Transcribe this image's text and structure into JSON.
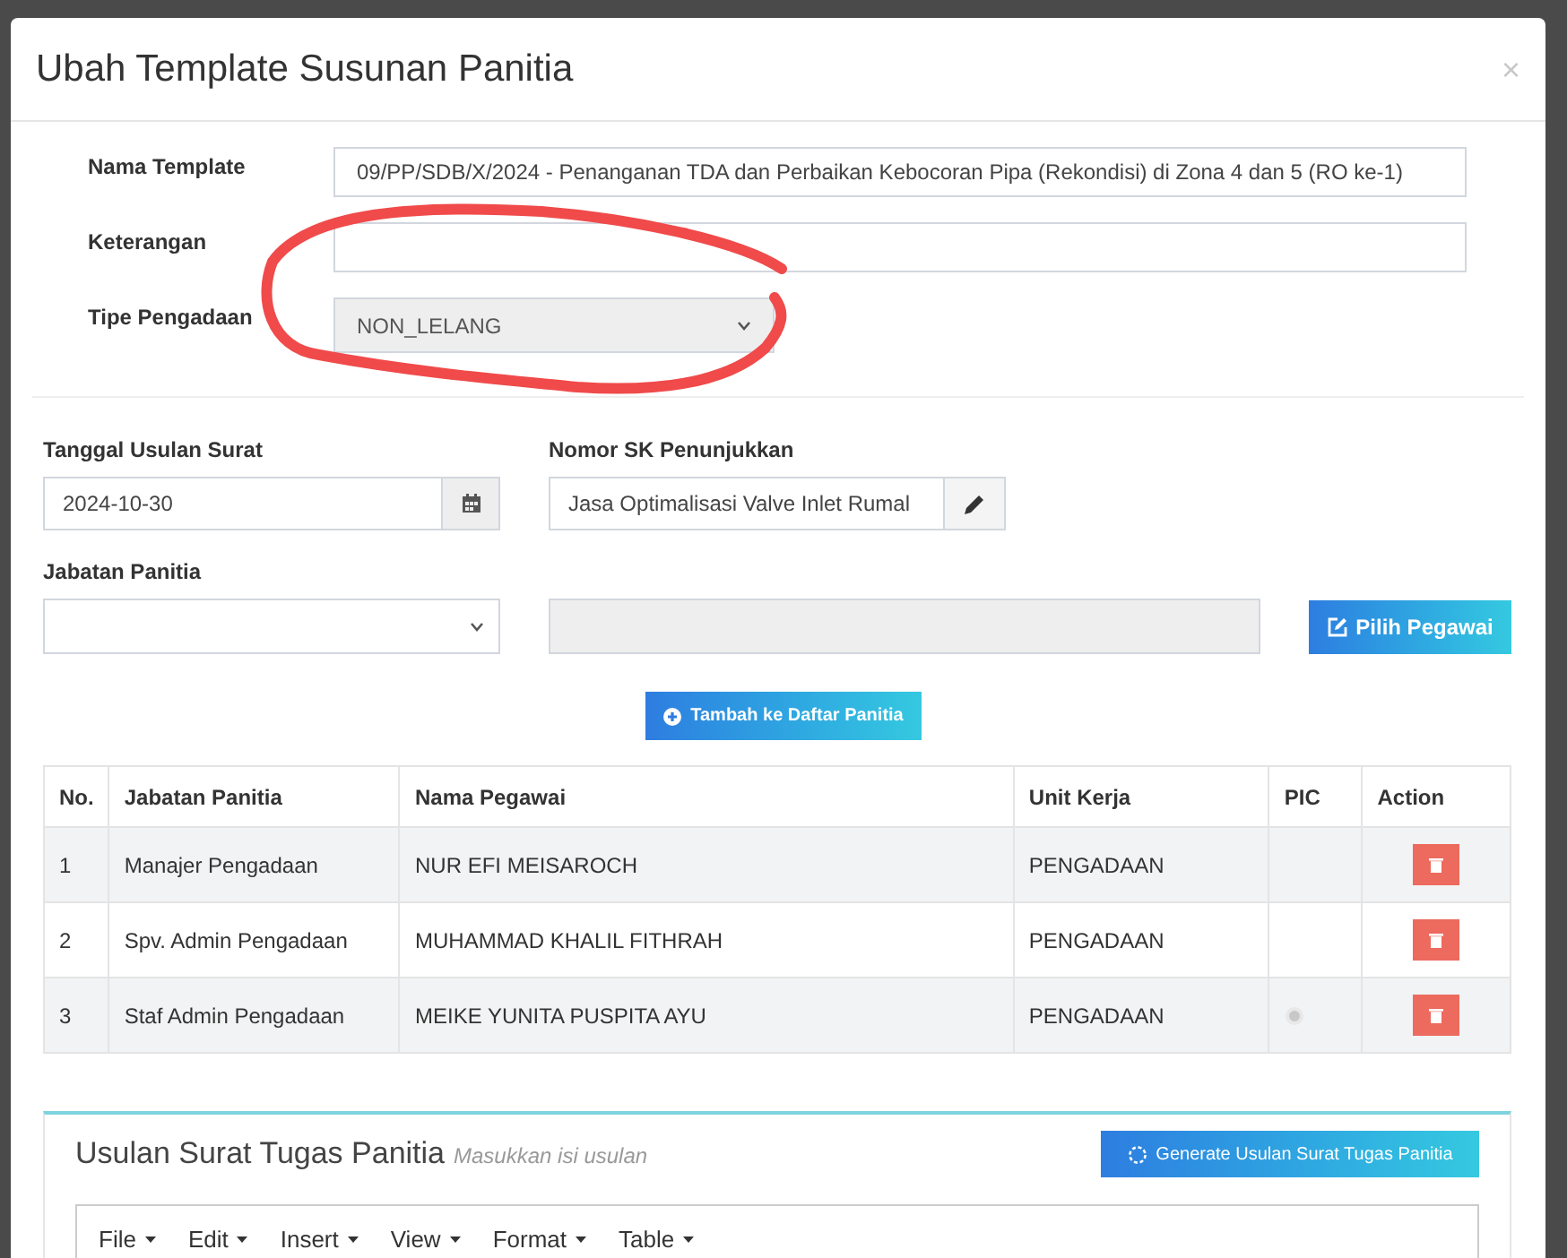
{
  "modal": {
    "title": "Ubah Template Susunan Panitia",
    "close": "×"
  },
  "template_form": [
    {
      "kind": "text",
      "label": "Nama Template",
      "value": "09/PP/SDB/X/2024 - Penanganan TDA dan Perbaikan Kebocoran Pipa (Rekondisi) di Zona 4 dan 5 (RO ke-1)"
    },
    {
      "kind": "text",
      "label": "Keterangan"
    },
    {
      "kind": "select",
      "label": "Tipe Pengadaan",
      "value": "NON_LELANG",
      "disabled": true
    }
  ],
  "tanggal": {
    "label": "Tanggal Usulan Surat",
    "value": "2024-10-30"
  },
  "nomor_sk": {
    "label": "Nomor SK Penunjukkan",
    "value": "Jasa Optimalisasi Valve Inlet Rumal"
  },
  "jabatan": {
    "label": "Jabatan Panitia",
    "button": "Pilih Pegawai"
  },
  "add_button": "Tambah ke Daftar Panitia",
  "table": {
    "columns": [
      "No.",
      "Jabatan Panitia",
      "Nama Pegawai",
      "Unit Kerja",
      "PIC",
      "Action"
    ],
    "rows": [
      {
        "no": "1",
        "jabatan": "Manajer Pengadaan",
        "nama": "NUR EFI MEISAROCH",
        "unit": "PENGADAAN",
        "pic": false
      },
      {
        "no": "2",
        "jabatan": "Spv. Admin Pengadaan",
        "nama": "MUHAMMAD KHALIL FITHRAH",
        "unit": "PENGADAAN",
        "pic": false
      },
      {
        "no": "3",
        "jabatan": "Staf Admin Pengadaan",
        "nama": "MEIKE YUNITA PUSPITA AYU",
        "unit": "PENGADAAN",
        "pic": true
      }
    ]
  },
  "usulan": {
    "title": "Usulan Surat Tugas Panitia",
    "subtitle": "Masukkan isi usulan",
    "button": "Generate Usulan Surat Tugas Panitia",
    "menu": [
      "File",
      "Edit",
      "Insert",
      "View",
      "Format",
      "Table"
    ]
  },
  "annotation": {
    "kind": "freehand-circle"
  }
}
